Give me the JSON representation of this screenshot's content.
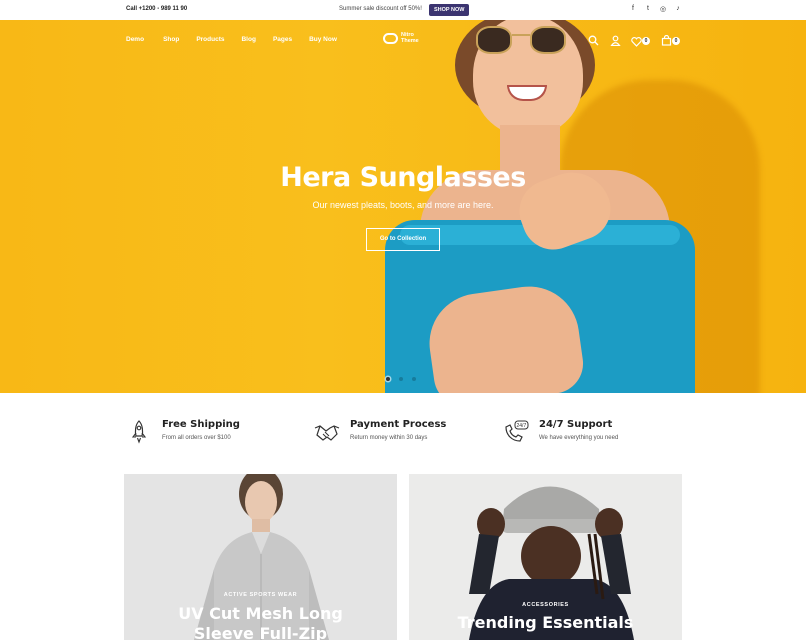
{
  "topbar": {
    "phone": "Call +1200 - 989 11 90",
    "promo": "Summer sale discount off 50%!",
    "shop_now": "SHOP NOW",
    "social": [
      {
        "name": "facebook-icon",
        "glyph": "f"
      },
      {
        "name": "twitter-icon",
        "glyph": "t"
      },
      {
        "name": "instagram-icon",
        "glyph": "◎"
      },
      {
        "name": "tiktok-icon",
        "glyph": "♪"
      }
    ]
  },
  "nav": {
    "items": [
      "Demo",
      "Shop",
      "Products",
      "Blog",
      "Pages",
      "Buy Now"
    ],
    "logo_line1": "Nitro",
    "logo_line2": "Theme",
    "wishlist_count": "0",
    "cart_count": "0"
  },
  "hero": {
    "title": "Hera Sunglasses",
    "subtitle": "Our newest pleats, boots, and more are here.",
    "button": "Go to Collection",
    "slides": 3,
    "active_slide": 1,
    "bg_color": "#f8b816"
  },
  "features": [
    {
      "icon": "rocket-icon",
      "glyph": "🚀",
      "title": "Free Shipping",
      "desc": "From all orders over $100"
    },
    {
      "icon": "handshake-icon",
      "glyph": "🤝",
      "title": "Payment Process",
      "desc": "Return money within 30 days"
    },
    {
      "icon": "support-phone-icon",
      "glyph": "☎",
      "title": "24/7 Support",
      "desc": "We have everything you need"
    }
  ],
  "cards": [
    {
      "label": "ACTIVE SPORTS WEAR",
      "title_line1": "UV Cut Mesh Long",
      "title_line2": "Sleeve Full-Zip"
    },
    {
      "label": "ACCESSORIES",
      "title_line1": "Trending Essentials",
      "title_line2": ""
    }
  ]
}
